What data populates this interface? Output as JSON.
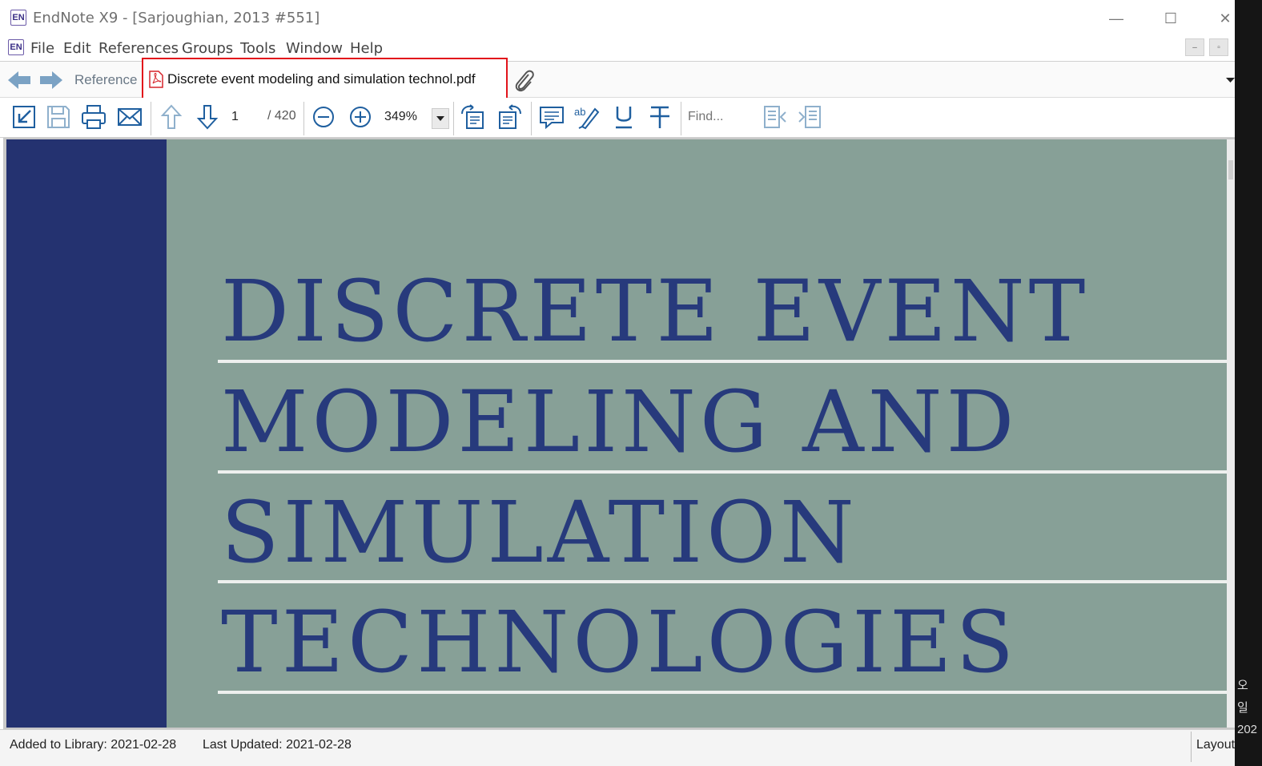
{
  "window": {
    "app_logo": "EN",
    "title": "EndNote X9 - [Sarjoughian, 2013 #551]",
    "controls": {
      "minimize": "—",
      "maximize": "☐",
      "close": "✕"
    },
    "mdi_controls": {
      "minimize": "–",
      "restore": "▫"
    }
  },
  "menubar": {
    "items": [
      "File",
      "Edit",
      "References",
      "Groups",
      "Tools",
      "Window",
      "Help"
    ]
  },
  "tabs": {
    "reference_label": "Reference",
    "pdf_label": "Discrete event modeling and simulation technol.pdf",
    "pdf_highlighted": true,
    "icons": {
      "back": "back-arrow-icon",
      "forward": "forward-arrow-icon",
      "pdf": "pdf-file-icon",
      "attach": "paperclip-icon",
      "overflow": "chevron-down-icon"
    }
  },
  "toolbar": {
    "page_current": "1",
    "page_total": "/ 420",
    "zoom": "349%",
    "find_placeholder": "Find...",
    "icons": [
      "open-external-icon",
      "save-icon",
      "print-icon",
      "email-icon",
      "previous-page-icon",
      "next-page-icon",
      "zoom-out-icon",
      "zoom-in-icon",
      "rotate-left-icon",
      "rotate-right-icon",
      "sticky-note-icon",
      "highlight-icon",
      "underline-icon",
      "strikethrough-icon",
      "find-previous-icon",
      "find-next-icon"
    ]
  },
  "document": {
    "title_lines": [
      "DISCRETE EVENT",
      "MODELING AND",
      "SIMULATION",
      "TECHNOLOGIES"
    ],
    "colors": {
      "band": "#243270",
      "background": "#87a097",
      "text": "#273a7c"
    }
  },
  "statusbar": {
    "added": "Added to Library: 2021-02-28",
    "updated": "Last Updated: 2021-02-28",
    "layout_label": "Layout"
  },
  "desktop": {
    "clock_lines": [
      "오",
      "일",
      "202"
    ]
  },
  "colors": {
    "accent_red": "#e2141b",
    "nav_blue": "#7ba2c4"
  }
}
